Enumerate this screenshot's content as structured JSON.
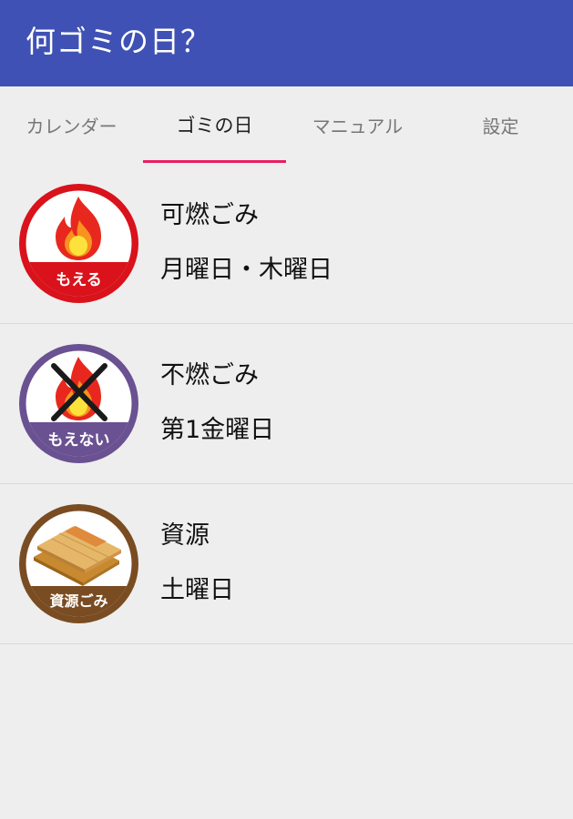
{
  "app": {
    "title": "何ゴミの日？"
  },
  "colors": {
    "appbar": "#3f51b5",
    "tab_indicator": "#e91e63",
    "background": "#eeeeee"
  },
  "tabs": [
    {
      "label": "カレンダー",
      "active": false
    },
    {
      "label": "ゴミの日",
      "active": true
    },
    {
      "label": "マニュアル",
      "active": false
    },
    {
      "label": "設定",
      "active": false
    }
  ],
  "garbage_list": [
    {
      "name": "可燃ごみ",
      "days": "月曜日・木曜日",
      "icon": "burnable-fire-icon",
      "badge_label": "もえる",
      "color": "#d9121b"
    },
    {
      "name": "不燃ごみ",
      "days": "第1金曜日",
      "icon": "non-burnable-crossed-fire-icon",
      "badge_label": "もえない",
      "color": "#6a5191"
    },
    {
      "name": "資源",
      "days": "土曜日",
      "icon": "resource-wood-boards-icon",
      "badge_label": "資源ごみ",
      "color": "#7a4c22"
    }
  ]
}
